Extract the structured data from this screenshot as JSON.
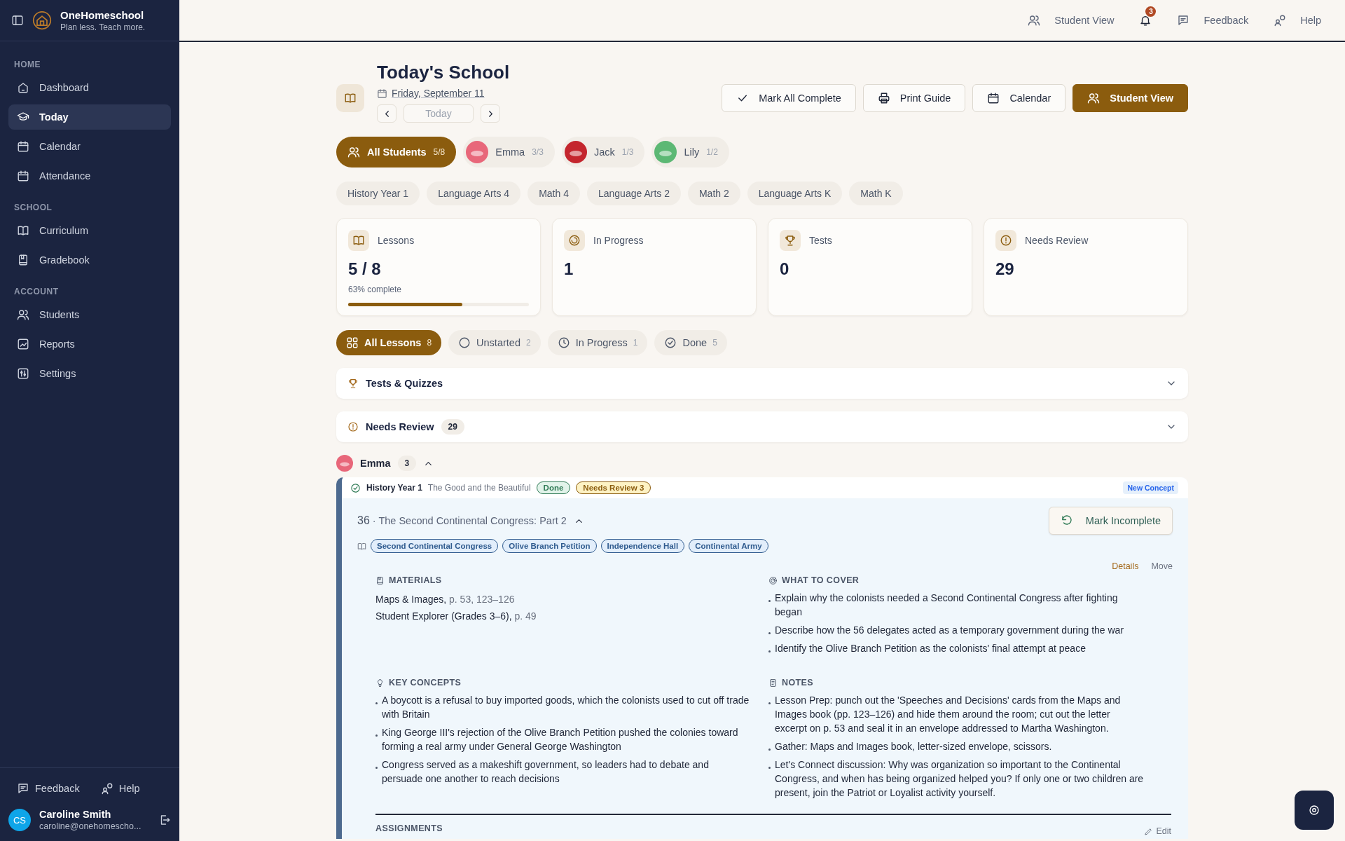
{
  "sidebar": {
    "brand": {
      "name": "OneHomeschool",
      "tagline": "Plan less. Teach more."
    },
    "sections": [
      {
        "heading": "HOME",
        "items": [
          {
            "label": "Dashboard",
            "selected": false
          },
          {
            "label": "Today",
            "selected": true
          },
          {
            "label": "Calendar",
            "selected": false
          },
          {
            "label": "Attendance",
            "selected": false
          }
        ]
      },
      {
        "heading": "SCHOOL",
        "items": [
          {
            "label": "Curriculum",
            "selected": false
          },
          {
            "label": "Gradebook",
            "selected": false
          }
        ]
      },
      {
        "heading": "ACCOUNT",
        "items": [
          {
            "label": "Students",
            "selected": false
          },
          {
            "label": "Reports",
            "selected": false
          },
          {
            "label": "Settings",
            "selected": false
          }
        ]
      }
    ],
    "footer_links": [
      "Feedback",
      "Help"
    ],
    "user": {
      "initials": "CS",
      "name": "Caroline Smith",
      "email": "caroline@onehomescho..."
    }
  },
  "topbar": {
    "items": [
      {
        "kind": "link",
        "label": "Student View"
      },
      {
        "kind": "bell",
        "badge": "3"
      },
      {
        "kind": "link",
        "label": "Feedback"
      },
      {
        "kind": "link",
        "label": "Help"
      }
    ]
  },
  "header": {
    "title": "Today's School",
    "date": "Friday, September 11",
    "today": "Today"
  },
  "actions": [
    {
      "label": "Mark All Complete",
      "kind": "outline"
    },
    {
      "label": "Print Guide",
      "kind": "outline"
    },
    {
      "label": "Calendar",
      "kind": "outline"
    },
    {
      "label": "Student View",
      "kind": "primary"
    }
  ],
  "students": [
    {
      "name": "All Students",
      "count": "5/8",
      "selected": true
    },
    {
      "name": "Emma",
      "count": "3/3",
      "selected": false,
      "color": "#e8677a"
    },
    {
      "name": "Jack",
      "count": "1/3",
      "selected": false,
      "color": "#c4262e"
    },
    {
      "name": "Lily",
      "count": "1/2",
      "selected": false,
      "color": "#5cb874"
    }
  ],
  "subjects": [
    "History Year 1",
    "Language Arts 4",
    "Math 4",
    "Language Arts 2",
    "Math 2",
    "Language Arts K",
    "Math K"
  ],
  "stats": [
    {
      "label": "Lessons",
      "value": "5 / 8",
      "caption": "63% complete",
      "level": 0.63
    },
    {
      "label": "In Progress",
      "value": "1"
    },
    {
      "label": "Tests",
      "value": "0"
    },
    {
      "label": "Needs Review",
      "value": "29"
    }
  ],
  "filters": [
    {
      "label": "All Lessons",
      "count": "8",
      "selected": true
    },
    {
      "label": "Unstarted",
      "count": "2",
      "selected": false
    },
    {
      "label": "In Progress",
      "count": "1",
      "selected": false
    },
    {
      "label": "Done",
      "count": "5",
      "selected": false
    }
  ],
  "panels": [
    {
      "title": "Tests & Quizzes",
      "expanded": false
    },
    {
      "title": "Needs Review",
      "count": "29",
      "expanded": false
    }
  ],
  "group": {
    "name": "Emma",
    "count": "3",
    "expanded": true,
    "color": "#e8677a",
    "lesson": {
      "subject": "History Year 1",
      "curriculum": "The Good and the Beautiful",
      "badges": [
        {
          "label": "Done",
          "kind": "done"
        },
        {
          "label": "Needs Review 3",
          "kind": "review"
        }
      ],
      "tag": "New Concept",
      "number": "36",
      "separator": "·",
      "title": "The Second Continental Congress: Part 2",
      "expanded": true,
      "button": "Mark Incomplete",
      "topics": [
        "Second Continental Congress",
        "Olive Branch Petition",
        "Independence Hall",
        "Continental Army"
      ],
      "links": [
        "Details",
        "Move"
      ],
      "materials": {
        "heading": "MATERIALS",
        "items": [
          {
            "name": "Maps & Images,",
            "pages": "p. 53, 123–126"
          },
          {
            "name": "Student Explorer (Grades 3–6),",
            "pages": "p. 49"
          }
        ]
      },
      "cover": {
        "heading": "WHAT TO COVER",
        "items": [
          "Explain why the colonists needed a Second Continental Congress after fighting began",
          "Describe how the 56 delegates acted as a temporary government during the war",
          "Identify the Olive Branch Petition as the colonists' final attempt at peace"
        ]
      },
      "concepts": {
        "heading": "KEY CONCEPTS",
        "items": [
          "A boycott is a refusal to buy imported goods, which the colonists used to cut off trade with Britain",
          "King George III's rejection of the Olive Branch Petition pushed the colonies toward forming a real army under General George Washington",
          "Congress served as a makeshift government, so leaders had to debate and persuade one another to reach decisions"
        ]
      },
      "notes": {
        "heading": "NOTES",
        "items": [
          "Lesson Prep: punch out the 'Speeches and Decisions' cards from the Maps and Images book (pp. 123–126) and hide them around the room; cut out the letter excerpt on p. 53 and seal it in an envelope addressed to Martha Washington.",
          "Gather: Maps and Images book, letter-sized envelope, scissors.",
          "Let's Connect discussion: Why was organization so important to the Continental Congress, and when has being organized helped you? If only one or two children are present, join the Patriot or Loyalist activity yourself."
        ]
      },
      "assignments": {
        "heading": "ASSIGNMENTS",
        "edit": "Edit"
      }
    }
  }
}
